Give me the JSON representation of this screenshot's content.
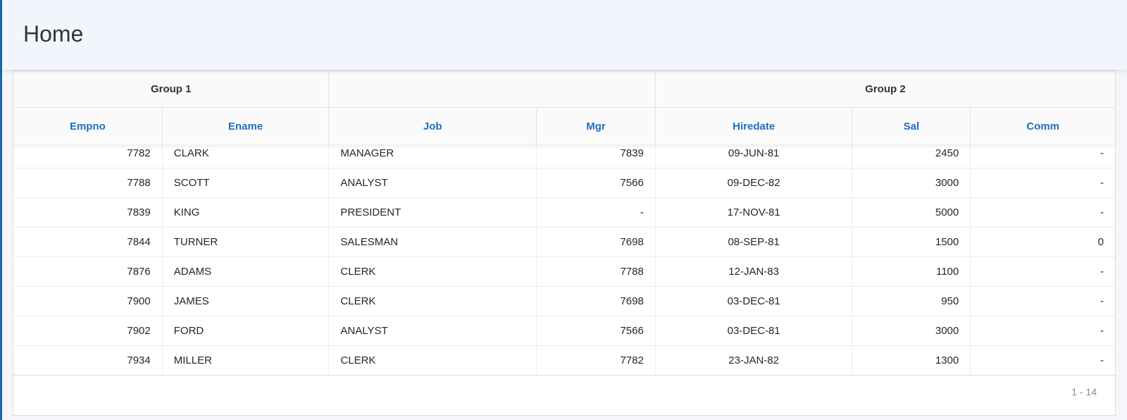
{
  "page": {
    "title": "Home"
  },
  "report": {
    "group_headers": [
      "Group 1",
      "",
      "Group 2"
    ],
    "columns": [
      "Empno",
      "Ename",
      "Job",
      "Mgr",
      "Hiredate",
      "Sal",
      "Comm"
    ],
    "rows": [
      [
        "7782",
        "CLARK",
        "MANAGER",
        "7839",
        "09-JUN-81",
        "2450",
        "-"
      ],
      [
        "7788",
        "SCOTT",
        "ANALYST",
        "7566",
        "09-DEC-82",
        "3000",
        "-"
      ],
      [
        "7839",
        "KING",
        "PRESIDENT",
        "-",
        "17-NOV-81",
        "5000",
        "-"
      ],
      [
        "7844",
        "TURNER",
        "SALESMAN",
        "7698",
        "08-SEP-81",
        "1500",
        "0"
      ],
      [
        "7876",
        "ADAMS",
        "CLERK",
        "7788",
        "12-JAN-83",
        "1100",
        "-"
      ],
      [
        "7900",
        "JAMES",
        "CLERK",
        "7698",
        "03-DEC-81",
        "950",
        "-"
      ],
      [
        "7902",
        "FORD",
        "ANALYST",
        "7566",
        "03-DEC-81",
        "3000",
        "-"
      ],
      [
        "7934",
        "MILLER",
        "CLERK",
        "7782",
        "23-JAN-82",
        "1300",
        "-"
      ]
    ],
    "pagination": "1 - 14"
  },
  "colors": {
    "accent": "#1f6fbf",
    "header_bg": "#f2f6fc"
  }
}
